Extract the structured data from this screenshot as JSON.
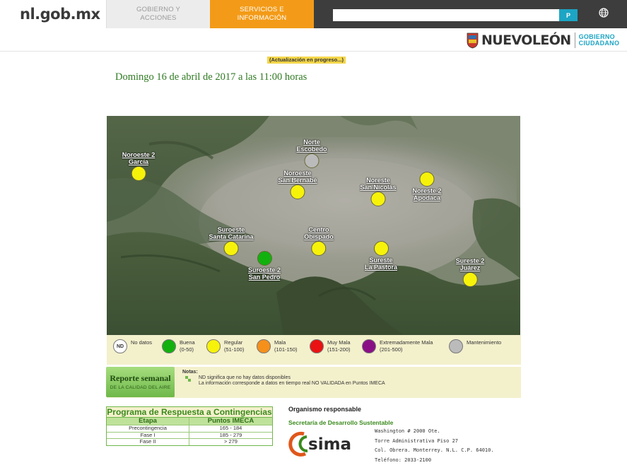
{
  "header": {
    "logo": "nl.gob.mx",
    "nav": [
      {
        "line1": "GOBIERNO Y",
        "line2": "ACCIONES"
      },
      {
        "line1": "SERVICIOS E",
        "line2": "INFORMACIÓN"
      }
    ],
    "search_button": "P",
    "globe_icon": "globe-icon",
    "brand_name": "NUEVOLEÓN",
    "brand_sub1": "GOBIERNO",
    "brand_sub2": "CIUDADANO",
    "accent": "#f39b18",
    "brand_color": "#1ca5c4"
  },
  "update_badge": "(Actualización en progreso...)",
  "date_line": "Domingo 16 de abril de 2017 a las 11:00 horas",
  "stations": [
    {
      "line1": "Noroeste 2",
      "line2": "García",
      "status": "regular",
      "label_first": true
    },
    {
      "line1": "Norte",
      "line2": "Escobedo",
      "status": "mantenimiento",
      "label_first": true
    },
    {
      "line1": "Noroeste",
      "line2": "San Bernabé",
      "status": "regular",
      "label_first": true
    },
    {
      "line1": "Noreste",
      "line2": "San Nicolás",
      "status": "regular",
      "label_first": true
    },
    {
      "line1": "Noreste 2",
      "line2": "Apodaca",
      "status": "regular",
      "label_first": false
    },
    {
      "line1": "Suroeste",
      "line2": "Santa Catarina",
      "status": "regular",
      "label_first": true
    },
    {
      "line1": "Centro",
      "line2": "Obispado",
      "status": "regular",
      "label_first": true
    },
    {
      "line1": "Suroeste 2",
      "line2": "San Pedro",
      "status": "buena",
      "label_first": false
    },
    {
      "line1": "Sureste",
      "line2": "La Pastora",
      "status": "regular",
      "label_first": false
    },
    {
      "line1": "Sureste 2",
      "line2": "Juárez",
      "status": "regular",
      "label_first": true
    }
  ],
  "legend": [
    {
      "key": "nd",
      "symbol": "ND",
      "label1": "No datos",
      "label2": "",
      "color": "#ffffff"
    },
    {
      "key": "buena",
      "label1": "Buena",
      "label2": "(0-50)",
      "color": "#12b10e"
    },
    {
      "key": "regular",
      "label1": "Regular",
      "label2": "(51-100)",
      "color": "#f7f20a"
    },
    {
      "key": "mala",
      "label1": "Mala",
      "label2": "(101-150)",
      "color": "#f5901b"
    },
    {
      "key": "muymala",
      "label1": "Muy Mala",
      "label2": "(151-200)",
      "color": "#ea1212"
    },
    {
      "key": "extmala",
      "label1": "Extremadamente Mala",
      "label2": "(201-500)",
      "color": "#8a0f86"
    },
    {
      "key": "mantenimiento",
      "label1": "Mantenimiento",
      "label2": "",
      "color": "#bbbbbb"
    }
  ],
  "report": {
    "title": "Reporte semanal",
    "subtitle": "DE LA CALIDAD DEL AIRE"
  },
  "notes": {
    "title": "Notas:",
    "lines": [
      "ND significa que no hay datos disponibles",
      "La información corresponde a datos en tiempo real NO VALIDADA en Puntos IMECA"
    ]
  },
  "contingency": {
    "title": "Programa de Respuesta a Contingencias",
    "headers": [
      "Etapa",
      "Puntos IMECA"
    ],
    "rows": [
      [
        "Precontingencia",
        "165 - 184"
      ],
      [
        "Fase I",
        "185 - 279"
      ],
      [
        "Fase II",
        "> 279"
      ]
    ]
  },
  "organismo": {
    "title": "Organismo responsable",
    "secretaria": "Secretaría de Desarrollo Sustentable",
    "logo": "sima",
    "address": [
      "Washington # 2000 Ote.",
      "Torre Administrativa Piso 27",
      "Col. Obrera. Monterrey. N.L. C.P. 64010.",
      "Teléfono: 2033-2100"
    ]
  }
}
